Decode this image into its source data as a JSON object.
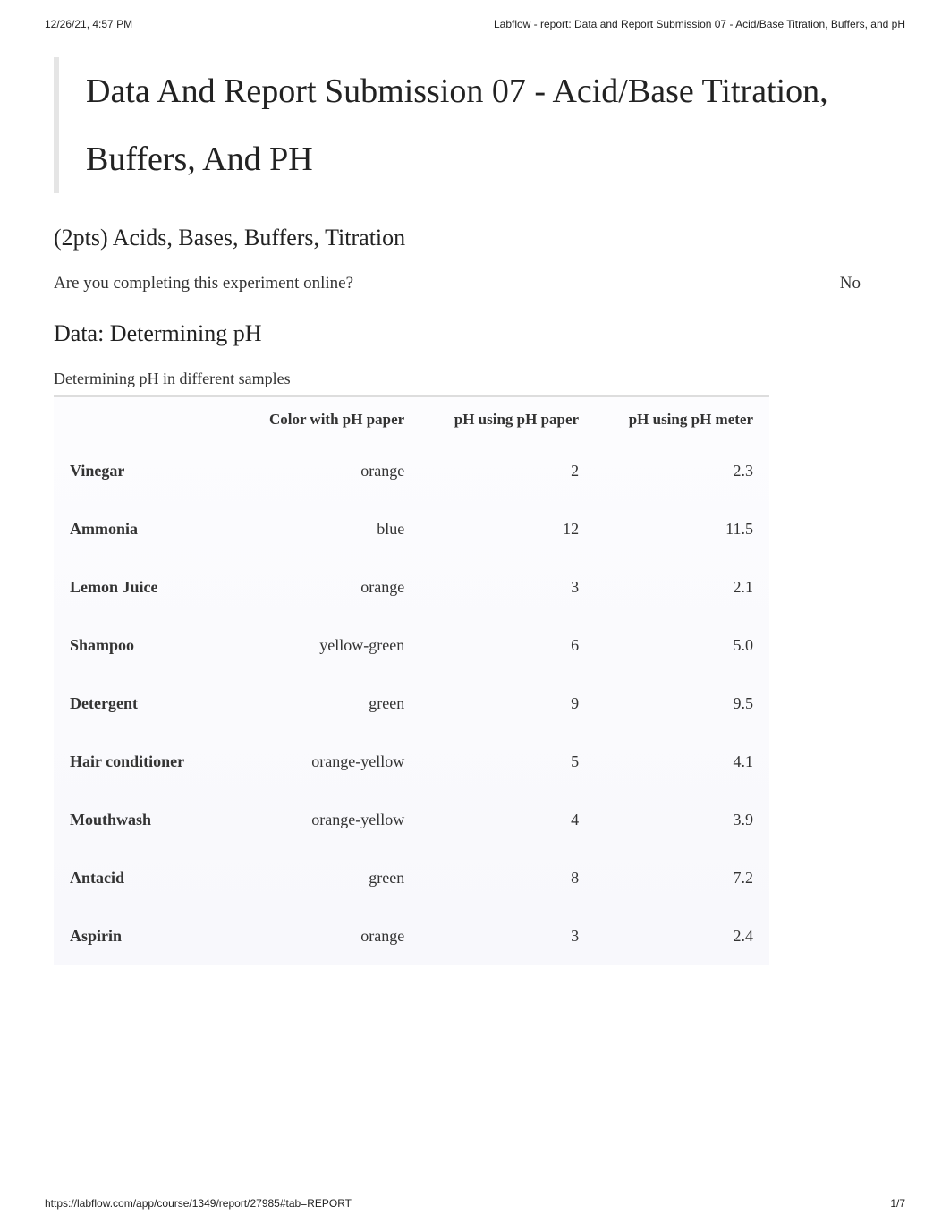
{
  "header": {
    "timestamp": "12/26/21, 4:57 PM",
    "page_title": "Labflow - report: Data and Report Submission 07 - Acid/Base Titration, Buffers, and pH"
  },
  "main_title": "Data And Report Submission 07 - Acid/Base Titration, Buffers, And PH",
  "section1": {
    "heading": "(2pts) Acids, Bases, Buffers, Titration",
    "question": "Are you completing this experiment online?",
    "answer": "No"
  },
  "section2": {
    "heading": "Data: Determining pH",
    "table_caption": "Determining pH in different samples",
    "columns": {
      "sample": "",
      "color": "Color with pH paper",
      "ph_paper": "pH using pH paper",
      "ph_meter": "pH using pH meter"
    },
    "rows": [
      {
        "sample": "Vinegar",
        "color": "orange",
        "ph_paper": "2",
        "ph_meter": "2.3"
      },
      {
        "sample": "Ammonia",
        "color": "blue",
        "ph_paper": "12",
        "ph_meter": "11.5"
      },
      {
        "sample": "Lemon Juice",
        "color": "orange",
        "ph_paper": "3",
        "ph_meter": "2.1"
      },
      {
        "sample": "Shampoo",
        "color": "yellow-green",
        "ph_paper": "6",
        "ph_meter": "5.0"
      },
      {
        "sample": "Detergent",
        "color": "green",
        "ph_paper": "9",
        "ph_meter": "9.5"
      },
      {
        "sample": "Hair conditioner",
        "color": "orange-yellow",
        "ph_paper": "5",
        "ph_meter": "4.1"
      },
      {
        "sample": "Mouthwash",
        "color": "orange-yellow",
        "ph_paper": "4",
        "ph_meter": "3.9"
      },
      {
        "sample": "Antacid",
        "color": "green",
        "ph_paper": "8",
        "ph_meter": "7.2"
      },
      {
        "sample": "Aspirin",
        "color": "orange",
        "ph_paper": "3",
        "ph_meter": "2.4"
      }
    ]
  },
  "footer": {
    "url": "https://labflow.com/app/course/1349/report/27985#tab=REPORT",
    "page_num": "1/7"
  }
}
